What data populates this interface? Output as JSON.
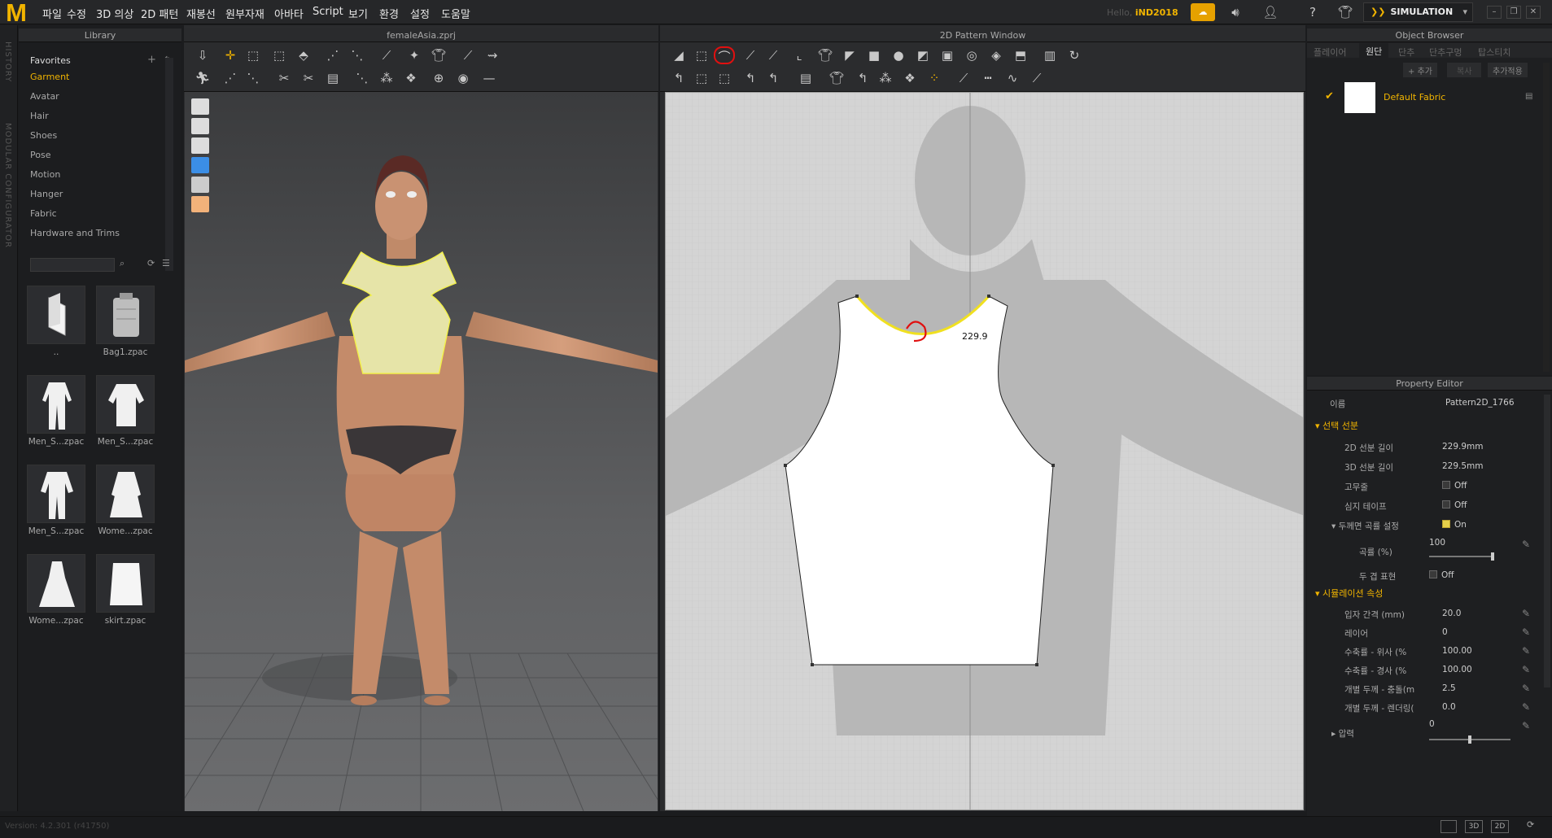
{
  "menu": {
    "items": [
      "파일",
      "수정",
      "3D 의상",
      "2D 패턴",
      "재봉선",
      "원부자재",
      "아바타",
      "Script",
      "보기",
      "환경",
      "설정",
      "도움말"
    ],
    "hello": "Hello,",
    "user": "iND2018",
    "simulation": "SIMULATION"
  },
  "sidebar": {
    "history": "HISTORY",
    "modular": "MODULAR CONFIGURATOR"
  },
  "library": {
    "title": "Library",
    "favorites": "Favorites",
    "items": [
      "Garment",
      "Avatar",
      "Hair",
      "Shoes",
      "Pose",
      "Motion",
      "Hanger",
      "Fabric",
      "Hardware and Trims"
    ],
    "thumbs": [
      "..",
      "Bag1.zpac",
      "Men_S...zpac",
      "Men_S...zpac",
      "Men_S...zpac",
      "Wome...zpac",
      "Wome...zpac",
      "skirt.zpac"
    ]
  },
  "win3d": {
    "title": "femaleAsia.zprj"
  },
  "win2d": {
    "title": "2D Pattern Window",
    "measure": "229.9"
  },
  "object_browser": {
    "title": "Object Browser",
    "tabs": [
      "플레이어",
      "원단",
      "단추",
      "단추구멍",
      "탑스티치"
    ],
    "add": "+ 추가",
    "copy": "복사",
    "add_to": "추가적용",
    "fabric": "Default Fabric"
  },
  "property_editor": {
    "title": "Property Editor",
    "name_label": "이름",
    "name_value": "Pattern2D_1766",
    "section1": "선택 선분",
    "rows1": [
      {
        "label": "2D 선분 길이",
        "value": "229.9mm"
      },
      {
        "label": "3D 선분 길이",
        "value": "229.5mm"
      },
      {
        "label": "고무줄",
        "value": "Off"
      },
      {
        "label": "심지 테이프",
        "value": "Off"
      },
      {
        "label": "두께면 곡률 설정",
        "value": "On"
      },
      {
        "label": "곡률 (%)",
        "value": "100"
      },
      {
        "label": "두 겹 표현",
        "value": "Off"
      }
    ],
    "section2": "시뮬레이션 속성",
    "rows2": [
      {
        "label": "입자 간격 (mm)",
        "value": "20.0"
      },
      {
        "label": "레이어",
        "value": "0"
      },
      {
        "label": "수축률 - 위사 (%",
        "value": "100.00"
      },
      {
        "label": "수축률 - 경사 (%",
        "value": "100.00"
      },
      {
        "label": "개별 두께 - 충돌(m",
        "value": "2.5"
      },
      {
        "label": "개별 두께 - 렌더링(",
        "value": "0.0"
      },
      {
        "label": "압력",
        "value": "0"
      }
    ]
  },
  "status": {
    "version": "Version: 4.2.301 (r41750)"
  }
}
